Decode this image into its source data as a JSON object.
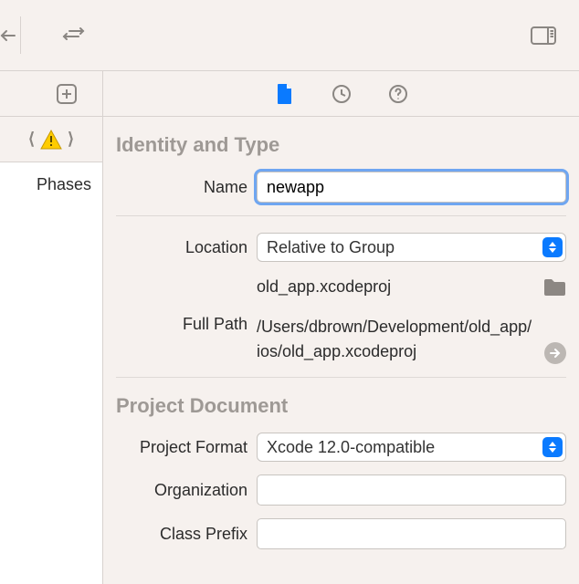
{
  "left": {
    "phases_label": "Phases"
  },
  "sections": {
    "identity": "Identity and Type",
    "project_doc": "Project Document"
  },
  "identity": {
    "name_label": "Name",
    "name_value": "newapp",
    "location_label": "Location",
    "location_select": "Relative to Group",
    "location_path": "old_app.xcodeproj",
    "fullpath_label": "Full Path",
    "fullpath_value": "/Users/dbrown/Development/old_app/ios/old_app.xcodeproj"
  },
  "project": {
    "format_label": "Project Format",
    "format_value": "Xcode 12.0-compatible",
    "org_label": "Organization",
    "org_value": "",
    "prefix_label": "Class Prefix",
    "prefix_value": ""
  }
}
